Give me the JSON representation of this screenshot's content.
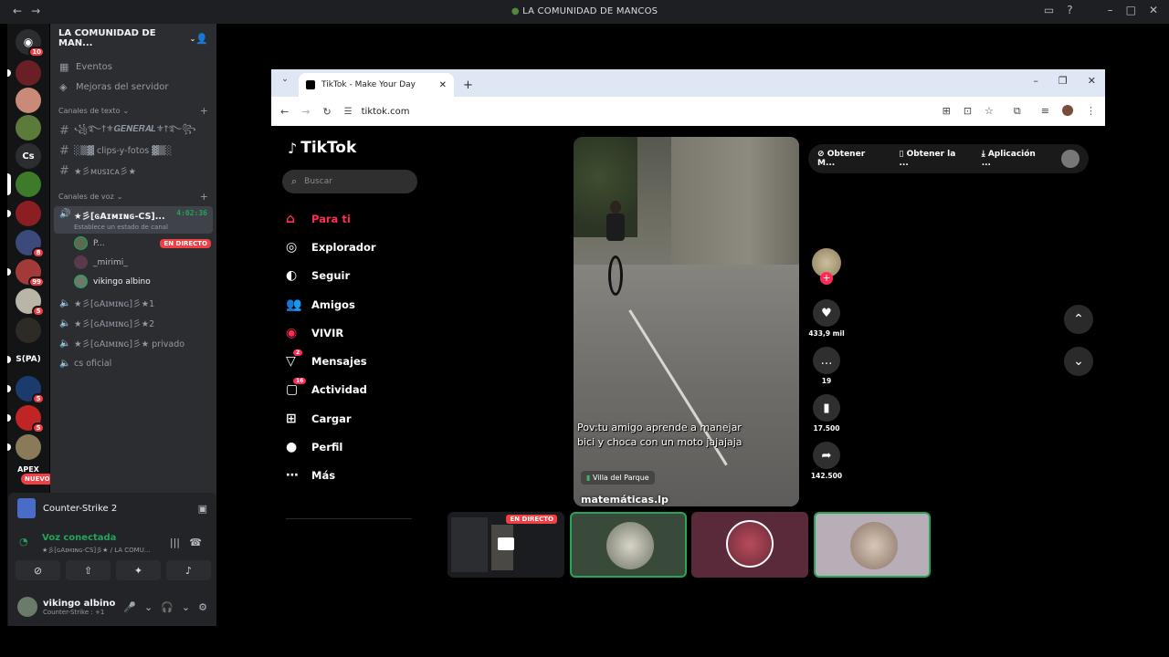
{
  "window": {
    "title": "LA COMUNIDAD DE MANCOS"
  },
  "rail": {
    "badges": [
      "10",
      "8",
      "99",
      "5",
      "5",
      "5",
      "5"
    ],
    "cs_label": "Cs",
    "spa_label": "S(PA)",
    "apex_label": "APEX",
    "nuevo_label": "NUEVO"
  },
  "server": {
    "name": "LA COMUNIDAD DE MAN...",
    "events_label": "Eventos",
    "boost_label": "Mejoras del servidor",
    "text_category": "Canales de texto",
    "voice_category": "Canales de voz",
    "text_channels": [
      "꧁࿐†⚜𝑮𝑬𝑵𝑬𝑹𝑨𝑳⚜†࿐꧂",
      "░▒▓ clips-y-fotos ▓▒░",
      "★彡ᴍᴜsɪᴄᴀ彡★"
    ],
    "active_voice": {
      "name": "★彡[ɢAɪᴍɪɴɢ-CS]...",
      "time": "4:02:36",
      "status": "Establece un estado de canal"
    },
    "voice_users": [
      {
        "name": "P...",
        "live": "EN DIRECTO"
      },
      {
        "name": "_mirimi_",
        "live": ""
      },
      {
        "name": "vikingo albino",
        "live": ""
      }
    ],
    "voice_channels": [
      "★彡[ɢAɪᴍɪɴɢ]彡★1",
      "★彡[ɢAɪᴍɪɴɢ]彡★2",
      "★彡[ɢAɪᴍɪɴɢ]彡★ privado",
      "cs oficial"
    ]
  },
  "game": {
    "name": "Counter-Strike 2"
  },
  "voice_panel": {
    "connected": "Voz conectada",
    "channel": "★彡[ɢAɪᴍɪɴɢ-CS]彡★ / LA COMU..."
  },
  "user": {
    "name": "vikingo albino",
    "status": "Counter-Strike : +1"
  },
  "browser": {
    "tab_title": "TikTok - Make Your Day",
    "url": "tiktok.com"
  },
  "tiktok": {
    "logo": "TikTok",
    "search_placeholder": "Buscar",
    "nav": [
      {
        "label": "Para ti",
        "icon": "home-icon",
        "badge": ""
      },
      {
        "label": "Explorador",
        "icon": "compass-icon",
        "badge": ""
      },
      {
        "label": "Seguir",
        "icon": "following-avatar-icon",
        "badge": ""
      },
      {
        "label": "Amigos",
        "icon": "friends-icon",
        "badge": ""
      },
      {
        "label": "VIVIR",
        "icon": "live-icon",
        "badge": ""
      },
      {
        "label": "Mensajes",
        "icon": "messages-icon",
        "badge": "2"
      },
      {
        "label": "Actividad",
        "icon": "activity-icon",
        "badge": "16"
      },
      {
        "label": "Cargar",
        "icon": "upload-icon",
        "badge": ""
      },
      {
        "label": "Perfil",
        "icon": "profile-icon",
        "badge": ""
      },
      {
        "label": "Más",
        "icon": "more-icon",
        "badge": ""
      }
    ],
    "top_actions": [
      "Obtener M...",
      "Obtener la ...",
      "Aplicación ..."
    ],
    "video": {
      "caption_line1": "Pov:tu amigo aprende a manejar",
      "caption_line2": "bici y choca con un moto jajajaja",
      "location": "Villa del Parque",
      "watermark": "matemáticas.lp"
    },
    "counts": {
      "likes": "433,9 mil",
      "comments": "19",
      "saves": "17.500",
      "shares": "142.500"
    }
  },
  "streams": {
    "live_label": "EN DIRECTO"
  },
  "colors": {
    "discord_bg": "#2b2d31",
    "discord_green": "#23a55a",
    "discord_red": "#f23f43",
    "tiktok_red": "#fe2c55"
  }
}
